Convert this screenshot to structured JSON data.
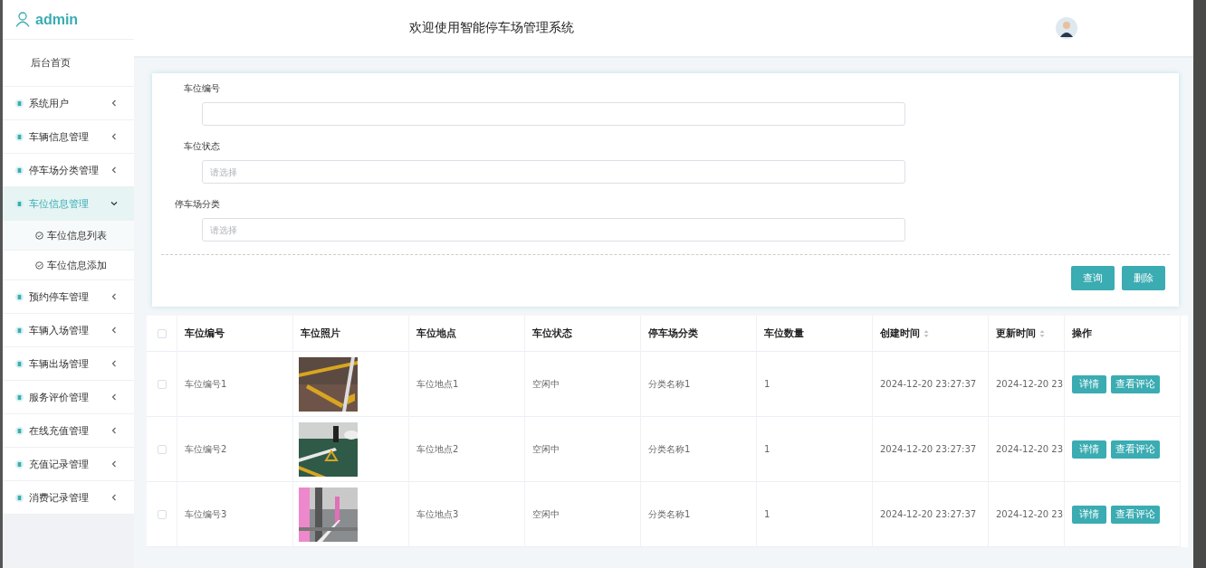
{
  "sidebar": {
    "user": "admin",
    "items": [
      {
        "label": "后台首页",
        "kind": "link"
      },
      {
        "label": "系统用户",
        "kind": "menu",
        "expanded": false
      },
      {
        "label": "车辆信息管理",
        "kind": "menu",
        "expanded": false
      },
      {
        "label": "停车场分类管理",
        "kind": "menu",
        "expanded": false
      },
      {
        "label": "车位信息管理",
        "kind": "menu",
        "expanded": true,
        "children": [
          {
            "label": "车位信息列表"
          },
          {
            "label": "车位信息添加"
          }
        ]
      },
      {
        "label": "预约停车管理",
        "kind": "menu",
        "expanded": false
      },
      {
        "label": "车辆入场管理",
        "kind": "menu",
        "expanded": false
      },
      {
        "label": "车辆出场管理",
        "kind": "menu",
        "expanded": false
      },
      {
        "label": "服务评价管理",
        "kind": "menu",
        "expanded": false
      },
      {
        "label": "在线充值管理",
        "kind": "menu",
        "expanded": false
      },
      {
        "label": "充值记录管理",
        "kind": "menu",
        "expanded": false
      },
      {
        "label": "消费记录管理",
        "kind": "menu",
        "expanded": false
      }
    ]
  },
  "header": {
    "title": "欢迎使用智能停车场管理系统"
  },
  "search_form": {
    "fields": [
      {
        "label": "车位编号"
      },
      {
        "label": "车位状态",
        "placeholder": "请选择"
      },
      {
        "label": "停车场分类",
        "placeholder": "请选择"
      }
    ],
    "buttons": [
      "查询",
      "删除"
    ]
  },
  "table": {
    "select_all": {
      "checked": false
    },
    "columns": [
      {
        "label": "车位编号",
        "sortable": false
      },
      {
        "label": "车位照片",
        "sortable": false
      },
      {
        "label": "车位地点",
        "sortable": false
      },
      {
        "label": "车位状态",
        "sortable": false
      },
      {
        "label": "停车场分类",
        "sortable": false
      },
      {
        "label": "车位数量",
        "sortable": false
      },
      {
        "label": "创建时间",
        "sortable": true
      },
      {
        "label": "更新时间",
        "sortable": true
      },
      {
        "label": "操作",
        "sortable": false
      }
    ],
    "rows": [
      {
        "checked": false,
        "number": "车位编号1",
        "location": "车位地点1",
        "status": "空闲中",
        "category": "分类名称1",
        "count": "1",
        "created": "2024-12-20 23:27:37",
        "updated": "2024-12-20 23",
        "actions": [
          "详情",
          "查看评论"
        ]
      },
      {
        "checked": false,
        "number": "车位编号2",
        "location": "车位地点2",
        "status": "空闲中",
        "category": "分类名称1",
        "count": "1",
        "created": "2024-12-20 23:27:37",
        "updated": "2024-12-20 23",
        "actions": [
          "详情",
          "查看评论"
        ]
      },
      {
        "checked": false,
        "number": "车位编号3",
        "location": "车位地点3",
        "status": "空闲中",
        "category": "分类名称1",
        "count": "1",
        "created": "2024-12-20 23:27:37",
        "updated": "2024-12-20 23",
        "actions": [
          "详情",
          "查看评论"
        ]
      }
    ]
  }
}
